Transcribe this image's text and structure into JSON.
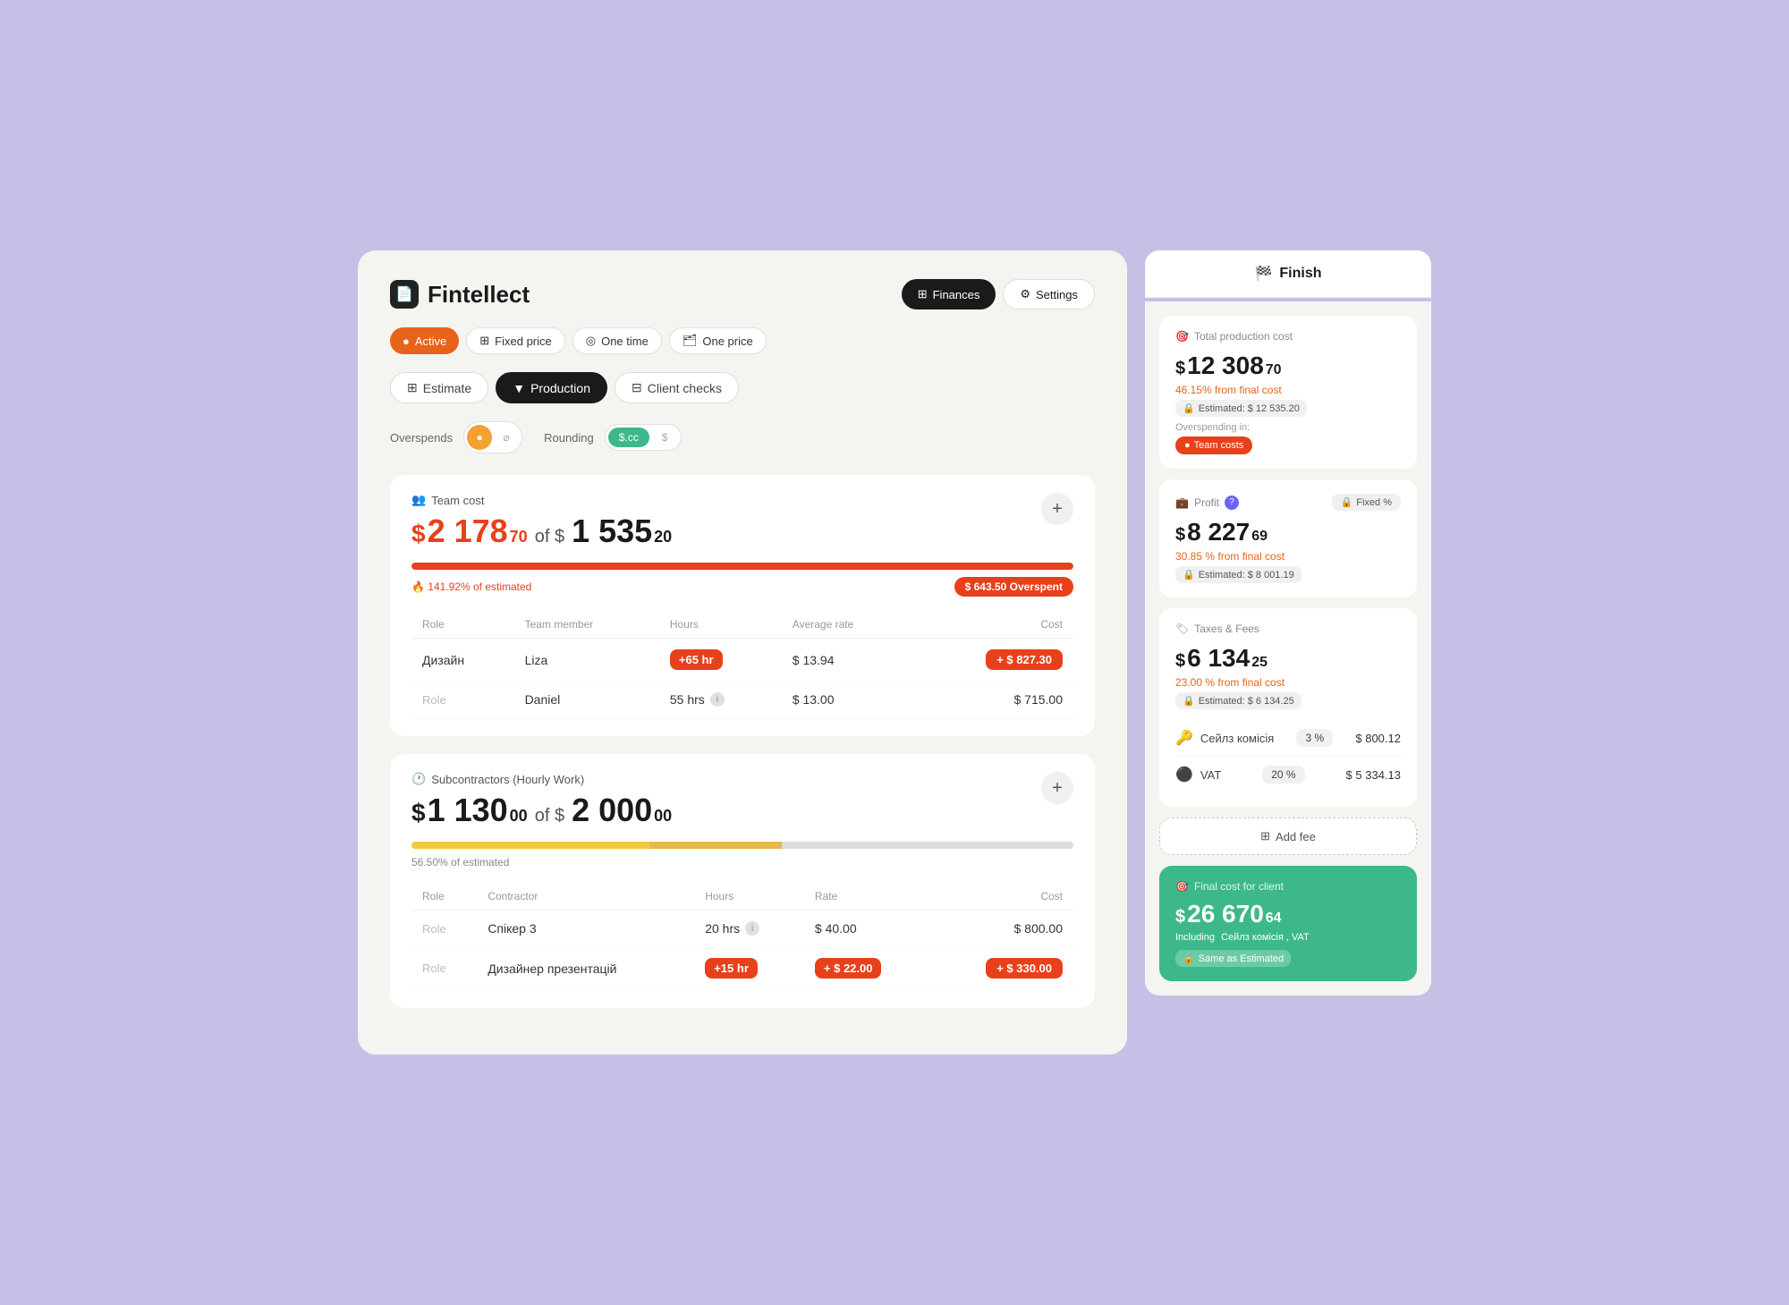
{
  "app": {
    "logo_icon": "📄",
    "logo_name": "Fintellect",
    "btn_finances": "Finances",
    "btn_settings": "Settings"
  },
  "status_tags": [
    {
      "label": "Active",
      "type": "active",
      "icon": "●"
    },
    {
      "label": "Fixed price",
      "type": "default",
      "icon": "⊞"
    },
    {
      "label": "One time",
      "type": "default",
      "icon": "◎"
    },
    {
      "label": "One price",
      "type": "default",
      "icon": "🗂"
    }
  ],
  "nav_tabs": [
    {
      "label": "Estimate",
      "icon": "⊞",
      "active": false
    },
    {
      "label": "Production",
      "icon": "▼",
      "active": true
    },
    {
      "label": "Client checks",
      "icon": "⊟",
      "active": false
    }
  ],
  "overspends": {
    "label": "Overspends",
    "toggle_on": "●",
    "toggle_off": "⌀",
    "rounding_label": "Rounding",
    "rounding_cc": "$.cc",
    "rounding_dollar": "$"
  },
  "team_cost": {
    "section_icon": "👥",
    "section_title": "Team cost",
    "amount": "2 178",
    "amount_decimal": "70",
    "of_label": "of $",
    "target": "1 535",
    "target_decimal": "20",
    "progress_pct": 100,
    "progress_label": "🔥 141.92% of estimated",
    "overspent_label": "$ 643.50 Overspent",
    "columns": [
      "Role",
      "Team member",
      "Hours",
      "Average rate",
      "Cost"
    ],
    "rows": [
      {
        "role": "Дизайн",
        "member": "Liza",
        "hours": "+65 hr",
        "hours_badge": true,
        "rate": "$ 13.94",
        "cost": "+ $ 827.30",
        "cost_badge": true
      },
      {
        "role": "Role",
        "role_empty": true,
        "member": "Daniel",
        "hours": "55 hrs",
        "hours_badge": false,
        "rate": "$ 13.00",
        "cost": "$ 715.00",
        "cost_badge": false
      }
    ]
  },
  "subcontractors": {
    "section_icon": "🕐",
    "section_title": "Subcontractors (Hourly Work)",
    "amount": "1 130",
    "amount_decimal": "00",
    "of_label": "of $",
    "target": "2 000",
    "target_decimal": "00",
    "progress_pct": 56.5,
    "progress_label": "56.50% of estimated",
    "columns": [
      "Role",
      "Contractor",
      "Hours",
      "Rate",
      "Cost"
    ],
    "rows": [
      {
        "role": "Role",
        "role_empty": true,
        "contractor": "Спікер 3",
        "hours": "20 hrs",
        "hours_badge": false,
        "rate": "$ 40.00",
        "cost": "$ 800.00",
        "cost_badge": false
      },
      {
        "role": "Role",
        "role_empty": true,
        "contractor": "Дизайнер презентацій",
        "hours": "+15 hr",
        "hours_badge": true,
        "rate": "+ $ 22.00",
        "rate_badge": true,
        "cost": "+ $ 330.00",
        "cost_badge": true
      }
    ]
  },
  "right_panel": {
    "finish_label": "Finish",
    "total_production": {
      "icon": "🎯",
      "title": "Total production cost",
      "amount": "12 308",
      "decimal": "70",
      "percent": "46.15% from final cost",
      "estimated_label": "Estimated: $ 12 535.20",
      "overspending_label": "Overspending in:",
      "team_costs_label": "Team costs"
    },
    "profit": {
      "icon": "💼",
      "title": "Profit",
      "badge": "Fixed %",
      "amount": "8 227",
      "decimal": "69",
      "percent": "30.85 % from final cost",
      "estimated_label": "Estimated: $ 8 001.19"
    },
    "taxes": {
      "icon": "🏷",
      "title": "Taxes & Fees",
      "amount": "6 134",
      "decimal": "25",
      "percent": "23.00 % from final cost",
      "estimated_label": "Estimated: $ 6 134.25",
      "items": [
        {
          "icon": "🔑",
          "name": "Сейлз комісія",
          "pct": "3 %",
          "value": "$ 800.12"
        },
        {
          "icon": "⚫",
          "name": "VAT",
          "pct": "20 %",
          "value": "$ 5 334.13"
        }
      ]
    },
    "add_fee_label": "Add fee",
    "final": {
      "icon": "🎯",
      "title": "Final cost for client",
      "amount": "26 670",
      "decimal": "64",
      "including_prefix": "Including",
      "including_items": "Сейлз комісія , VAT",
      "same_estimated": "Same as Estimated"
    }
  }
}
